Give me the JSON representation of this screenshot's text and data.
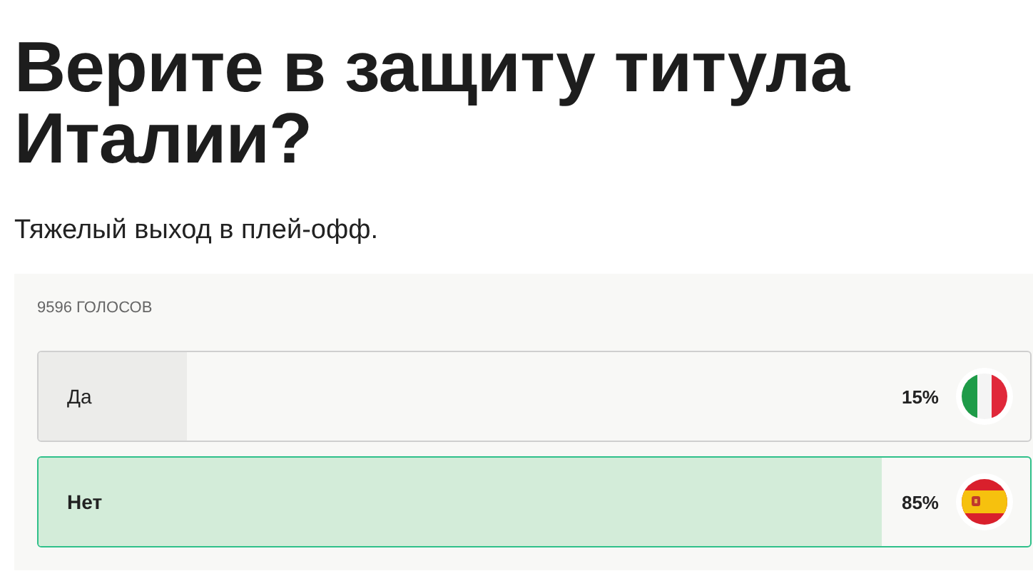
{
  "title": "Верите в защиту титула Италии?",
  "subtitle": "Тяжелый выход в плей-офф.",
  "poll": {
    "votes": "9596 ГОЛОСОВ",
    "options": [
      {
        "label": "Да",
        "percent": "15%",
        "level": 0.15,
        "selected": false,
        "kind": "italy"
      },
      {
        "label": "Нет",
        "percent": "85%",
        "level": 0.85,
        "selected": true,
        "kind": "spain"
      }
    ]
  }
}
